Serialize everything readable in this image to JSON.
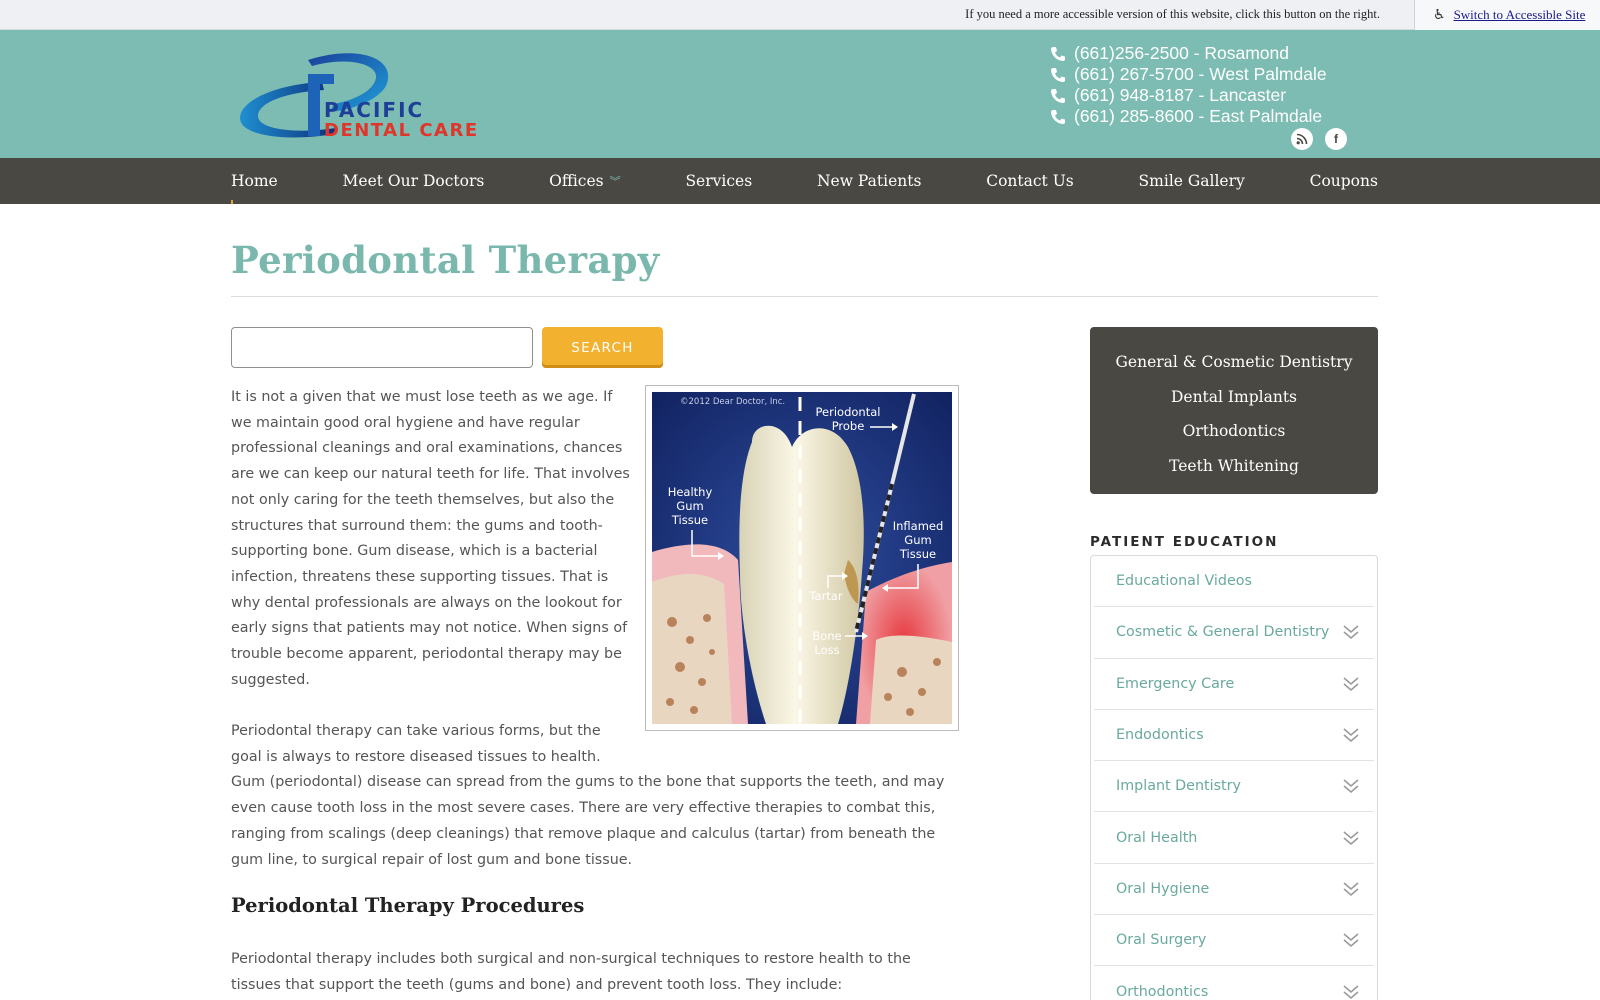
{
  "accessibility_bar": {
    "note": "If you need a more accessible version of this website, click this button on the right.",
    "button_label": "Switch to Accessible Site",
    "icon": "wheelchair-icon"
  },
  "header": {
    "logo": {
      "line1": "PACIFIC",
      "line2": "DENTAL CARE"
    },
    "phones": [
      {
        "text": "(661)256-2500 - Rosamond"
      },
      {
        "text": "(661) 267-5700 - West Palmdale"
      },
      {
        "text": "(661) 948-8187 - Lancaster"
      },
      {
        "text": "(661) 285-8600 - East Palmdale"
      }
    ],
    "social": [
      {
        "icon": "rss-icon"
      },
      {
        "icon": "facebook-icon",
        "glyph": "f"
      }
    ],
    "colors": {
      "band": "#7cbcb2"
    }
  },
  "nav": {
    "items": [
      {
        "label": "Home"
      },
      {
        "label": "Meet Our Doctors"
      },
      {
        "label": "Offices"
      },
      {
        "label": "Services"
      },
      {
        "label": "New Patients"
      },
      {
        "label": "Contact Us"
      },
      {
        "label": "Smile Gallery"
      },
      {
        "label": "Coupons"
      }
    ],
    "offices_icon": "chevron-down-icon"
  },
  "page": {
    "title": "Periodontal Therapy",
    "search": {
      "value": "",
      "placeholder": "",
      "button": "SEARCH"
    },
    "paragraph1": "It is not a given that we must lose teeth as we age. If we maintain good oral hygiene and have regular professional cleanings and oral examinations, chances are we can keep our natural teeth for life. That involves not only caring for the teeth themselves, but also the structures that surround them: the gums and tooth-supporting bone. Gum disease, which is a bacterial infection, threatens these supporting tissues. That is why dental professionals are always on the lookout for early signs that patients may not notice. When signs of trouble become apparent, periodontal therapy may be suggested.",
    "paragraph2": "Periodontal therapy can take various forms, but the goal is always to restore diseased tissues to health. Gum (periodontal) disease can spread from the gums to the bone that supports the teeth, and may even cause tooth loss in the most severe cases. There are very effective therapies to combat this, ranging from scalings (deep cleanings) that remove plaque and calculus (tartar) from beneath the gum line, to surgical repair of lost gum and bone tissue.",
    "subheading": "Periodontal Therapy Procedures",
    "paragraph3": "Periodontal therapy includes both surgical and non-surgical techniques to restore health to the tissues that support the teeth (gums and bone) and prevent tooth loss. They include:",
    "figure": {
      "copyright": "©2012 Dear Doctor, Inc.",
      "labels": {
        "probe1": "Periodontal",
        "probe2": "Probe",
        "healthy1": "Healthy",
        "healthy2": "Gum",
        "healthy3": "Tissue",
        "inflamed1": "Inflamed",
        "inflamed2": "Gum",
        "inflamed3": "Tissue",
        "tartar": "Tartar",
        "bone1": "Bone",
        "bone2": "Loss"
      }
    }
  },
  "sidebar": {
    "services": [
      {
        "label": "General & Cosmetic Dentistry"
      },
      {
        "label": "Dental Implants"
      },
      {
        "label": "Orthodontics"
      },
      {
        "label": "Teeth Whitening"
      }
    ],
    "patient_education": {
      "title": "PATIENT EDUCATION",
      "items": [
        {
          "label": "Educational Videos",
          "expandable": false
        },
        {
          "label": "Cosmetic & General Dentistry",
          "expandable": true
        },
        {
          "label": "Emergency Care",
          "expandable": true
        },
        {
          "label": "Endodontics",
          "expandable": true
        },
        {
          "label": "Implant Dentistry",
          "expandable": true
        },
        {
          "label": "Oral Health",
          "expandable": true
        },
        {
          "label": "Oral Hygiene",
          "expandable": true
        },
        {
          "label": "Oral Surgery",
          "expandable": true
        },
        {
          "label": "Orthodontics",
          "expandable": true
        }
      ]
    }
  }
}
